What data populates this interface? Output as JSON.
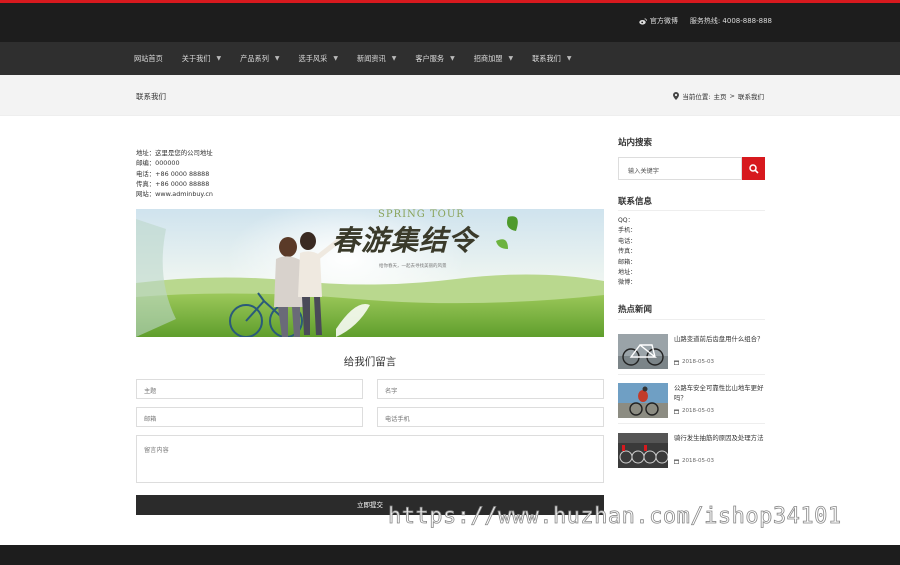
{
  "topbar": {
    "weibo_label": "官方微博",
    "hotline_label": "服务热线: 4008-888-888"
  },
  "nav": [
    {
      "label": "网站首页",
      "has_caret": false
    },
    {
      "label": "关于我们",
      "has_caret": true
    },
    {
      "label": "产品系列",
      "has_caret": true
    },
    {
      "label": "选手风采",
      "has_caret": true
    },
    {
      "label": "新闻资讯",
      "has_caret": true
    },
    {
      "label": "客户服务",
      "has_caret": true
    },
    {
      "label": "招商加盟",
      "has_caret": true
    },
    {
      "label": "联系我们",
      "has_caret": true
    }
  ],
  "crumb": {
    "title": "联系我们",
    "location_label": "当前位置:",
    "home": "主页",
    "sep": ">",
    "current": "联系我们"
  },
  "contact": {
    "address": "地址：这里是您的公司地址",
    "postcode": "邮编：000000",
    "phone": "电话：+86 0000 88888",
    "fax": "传真：+86 0000 88888",
    "website": "网站：www.adminbuy.cn"
  },
  "banner": {
    "en_text": "SPRING TOUR",
    "cn_text": "春游集结令",
    "sub_text": "给你春天，一起去寻找美丽的风景"
  },
  "form": {
    "title": "给我们留言",
    "subject_placeholder": "主题",
    "name_placeholder": "名字",
    "email_placeholder": "邮箱",
    "phone_placeholder": "电话手机",
    "message_placeholder": "留言内容",
    "submit_label": "立即提交"
  },
  "sidebar": {
    "search_title": "站内搜索",
    "search_placeholder": "输入关键字",
    "info_title": "联系信息",
    "info_items": [
      "QQ：",
      "手机：",
      "电话：",
      "传真：",
      "邮箱：",
      "地址：",
      "微博："
    ],
    "news_title": "热点新闻",
    "news": [
      {
        "title": "山路变道前后齿盘用什么组合？",
        "date": "2018-05-03"
      },
      {
        "title": "公路车安全可靠性比山地车更好吗？",
        "date": "2018-05-03"
      },
      {
        "title": "骑行发生抽筋的原因及处理方法",
        "date": "2018-05-03"
      }
    ]
  },
  "watermark": "https://www.huzhan.com/ishop34101",
  "colors": {
    "accent": "#d7191e",
    "topbar": "#1d1d1d",
    "nav": "#2f2f2f"
  }
}
